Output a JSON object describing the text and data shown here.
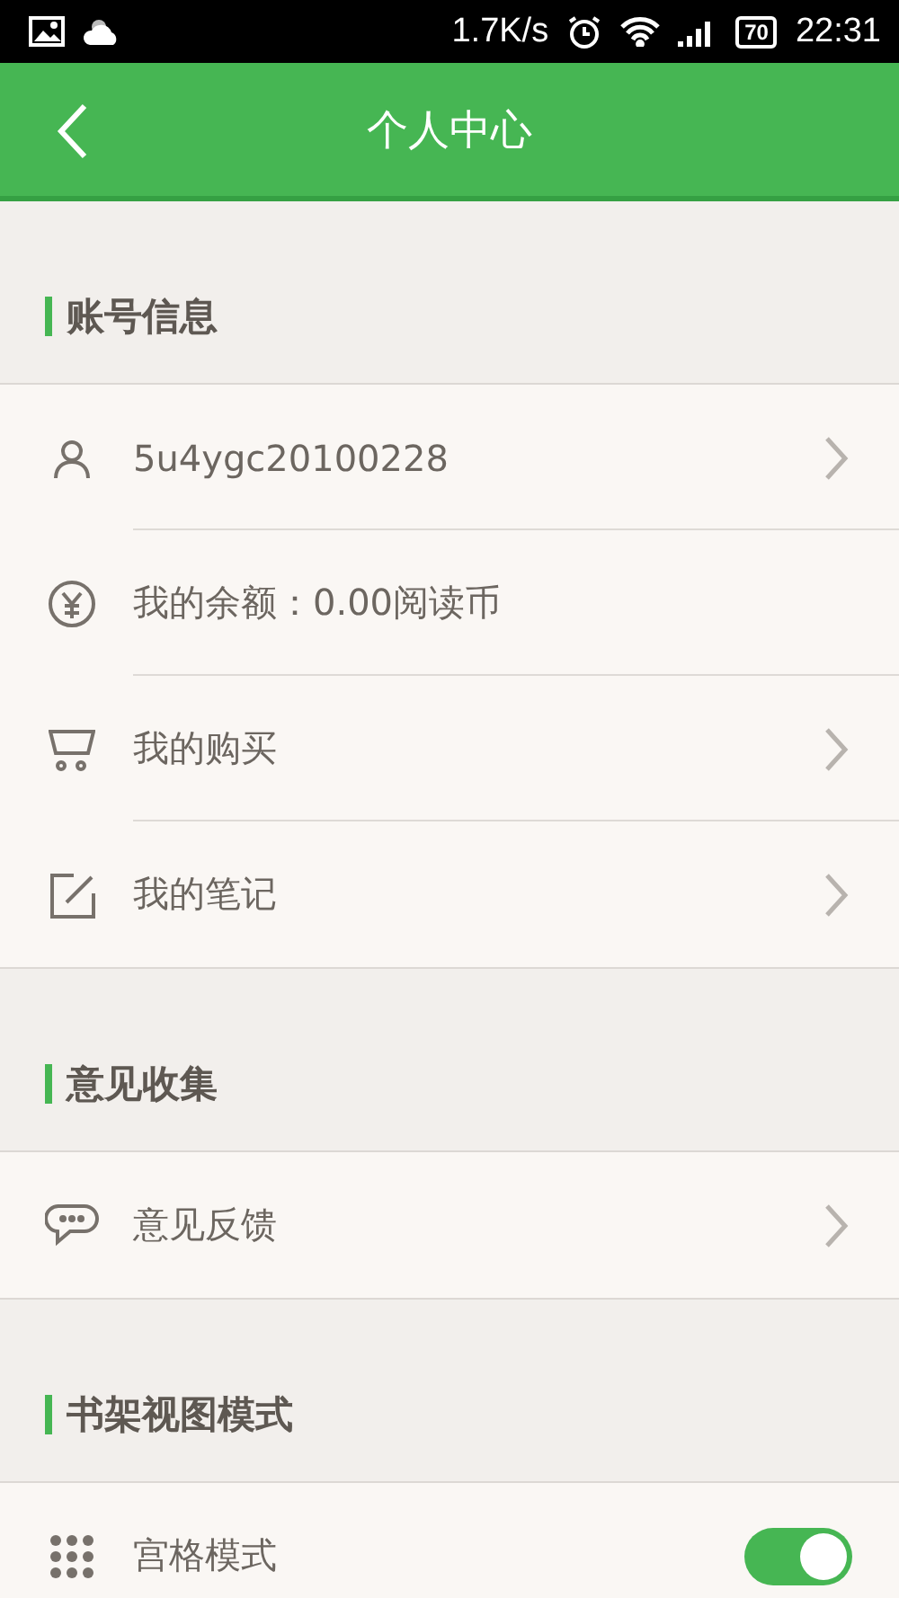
{
  "status_bar": {
    "speed": "1.7K/s",
    "battery": "70",
    "time": "22:31"
  },
  "header": {
    "title": "个人中心"
  },
  "sections": [
    {
      "title": "账号信息",
      "items": [
        {
          "kind": "link",
          "label": "5u4ygc20100228"
        },
        {
          "kind": "info",
          "label": "我的余额：0.00阅读币"
        },
        {
          "kind": "link",
          "label": "我的购买"
        },
        {
          "kind": "link",
          "label": "我的笔记"
        }
      ]
    },
    {
      "title": "意见收集",
      "items": [
        {
          "kind": "link",
          "label": "意见反馈"
        }
      ]
    },
    {
      "title": "书架视图模式",
      "items": [
        {
          "kind": "toggle",
          "label": "宫格模式",
          "on": true
        }
      ]
    }
  ]
}
